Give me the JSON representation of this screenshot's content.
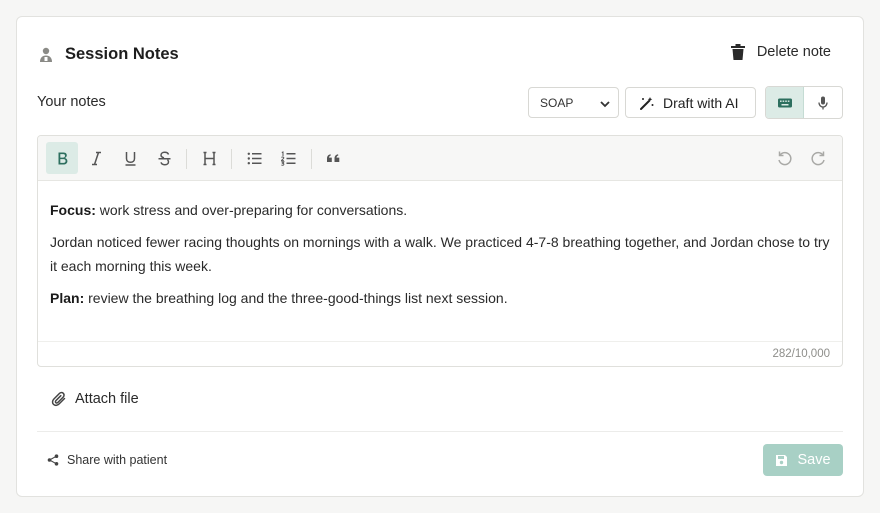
{
  "header": {
    "title": "Session Notes",
    "icon": "user-icon"
  },
  "actions": {
    "delete_label": "Delete note"
  },
  "notes_label": "Your notes",
  "template_select": {
    "selected": "SOAP",
    "options": [
      "SOAP"
    ]
  },
  "draft_button": {
    "label": "Draft with AI",
    "icon": "magic-wand-icon"
  },
  "input_mode": {
    "active": "keyboard",
    "modes": [
      "keyboard",
      "microphone"
    ]
  },
  "toolbar": {
    "buttons": [
      "bold",
      "italic",
      "underline",
      "strikethrough",
      "heading",
      "bullet-list",
      "numbered-list",
      "quote",
      "undo",
      "redo"
    ],
    "active": "bold"
  },
  "editor": {
    "p1_label": "Focus:",
    "p1_text": " work stress and over-preparing for conversations.",
    "p2_text": "Jordan noticed fewer racing thoughts on mornings with a walk. We practiced 4-7-8 breathing together, and Jordan chose to try it each morning this week.",
    "p3_label": "Plan:",
    "p3_text": " review the breathing log and the three-good-things list next session.",
    "counter": "282/10,000"
  },
  "attach_label": "Attach file",
  "footer": {
    "share_label": "Share with patient",
    "save_label": "Save"
  },
  "colors": {
    "accent": "#2d6f5f",
    "accent_light": "#dcebe6",
    "save_disabled": "#a8d0c5"
  }
}
